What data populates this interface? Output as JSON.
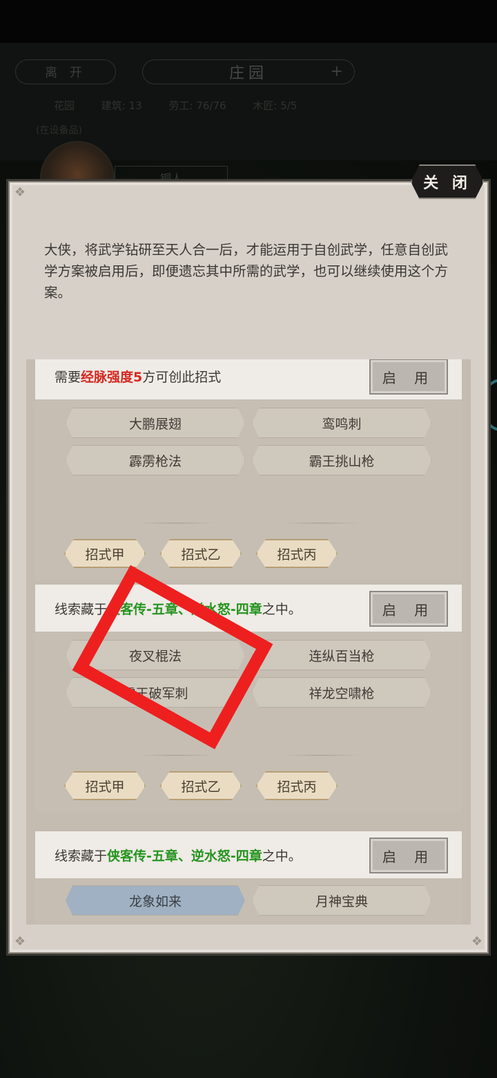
{
  "background": {
    "leave_label": "离 开",
    "title": "庄园",
    "plus_icon": "+",
    "stats": [
      "花园",
      "建筑: 13",
      "劳工: 76/76",
      "木匠: 5/5"
    ],
    "status_line": "(在设备品)",
    "npc_label": "铜人"
  },
  "modal": {
    "close_label": "关 闭",
    "intro": "大侠，将武学钻研至天人合一后，才能运用于自创武学，任意自创武学方案被启用后，即便遗忘其中所需的武学，也可以继续使用这个方案。",
    "enable_label": "启 用",
    "sections": [
      {
        "req_prefix": "需要",
        "req_highlight": "经脉强度5",
        "req_suffix": "方可创此招式",
        "skills": [
          "大鹏展翅",
          "鸾鸣刺",
          "霹雳枪法",
          "霸王挑山枪"
        ],
        "moves": [
          "招式甲",
          "招式乙",
          "招式丙"
        ]
      },
      {
        "req_prefix": "线索藏于",
        "req_highlight": "侠客传-五章、逆水怒-四章",
        "req_suffix": "之中。",
        "skills": [
          "夜叉棍法",
          "连纵百当枪",
          "霸王破军刺",
          "祥龙空啸枪"
        ],
        "moves": [
          "招式甲",
          "招式乙",
          "招式丙"
        ]
      },
      {
        "req_prefix": "线索藏于",
        "req_highlight": "侠客传-五章、逆水怒-四章",
        "req_suffix": "之中。",
        "skills": [
          "龙象如来",
          "月神宝典"
        ]
      }
    ]
  },
  "colors": {
    "highlight_red": "#d6281f",
    "highlight_green": "#25941f",
    "annotation_box": "#ee1f1f"
  }
}
